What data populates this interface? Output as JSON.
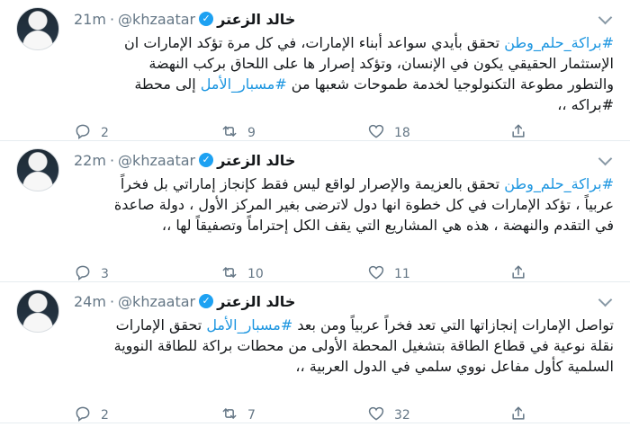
{
  "tweets": [
    {
      "name": "خالد الزعتر",
      "handle": "@khzaatar",
      "separator": "·",
      "time": "21m",
      "lines": [
        [
          {
            "hashtag": "#براكة_حلم_وطن"
          },
          {
            "text": " تحقق بأيدي سواعد أبناء الإمارات، في كل مرة تؤكد الإمارات ان"
          }
        ],
        [
          {
            "text": "الإستثمار الحقيقي يكون في الإنسان، وتؤكد إصرار ها على اللحاق بركب النهضة"
          }
        ],
        [
          {
            "text": "والتطور مطوعة التكنولوجيا لخدمة طموحات شعبها من "
          },
          {
            "hashtag": "#مسبار_الأمل"
          },
          {
            "text": " إلى محطة"
          }
        ],
        [
          {
            "text": "#براكه ،،"
          }
        ]
      ],
      "replies": "2",
      "retweets": "9",
      "likes": "18"
    },
    {
      "name": "خالد الزعتر",
      "handle": "@khzaatar",
      "separator": "·",
      "time": "22m",
      "lines": [
        [
          {
            "hashtag": "#براكة_حلم_وطن"
          },
          {
            "text": " تحقق بالعزيمة والإصرار لواقع ليس فقط كإنجاز إماراتي بل فخراً"
          }
        ],
        [
          {
            "text": "عربياً ، تؤكد الإمارات في كل خطوة انها دول لاترضى بغير المركز الأول ، دولة صاعدة"
          }
        ],
        [
          {
            "text": "في التقدم والنهضة ، هذه هي المشاريع التي يقف الكل إحتراماً وتصفيقاً لها ،،"
          }
        ]
      ],
      "replies": "3",
      "retweets": "10",
      "likes": "11"
    },
    {
      "name": "خالد الزعتر",
      "handle": "@khzaatar",
      "separator": "·",
      "time": "24m",
      "lines": [
        [
          {
            "text": "تواصل الإمارات إنجازاتها التي تعد فخراً عربياً ومن بعد "
          },
          {
            "hashtag": "#مسبار_الأمل"
          },
          {
            "text": " تحقق الإمارات"
          }
        ],
        [
          {
            "text": "نقلة نوعية في قطاع الطاقة بتشغيل المحطة الأولى من محطات براكة للطاقة النووية"
          }
        ],
        [
          {
            "text": "السلمية كأول مفاعل نووي سلمي في الدول العربية ،،"
          }
        ]
      ],
      "replies": "2",
      "retweets": "7",
      "likes": "32"
    }
  ],
  "icons": {
    "verified": "verified-badge-icon",
    "reply": "reply-icon",
    "retweet": "retweet-icon",
    "like": "heart-icon",
    "share": "share-icon",
    "more": "chevron-down-icon"
  },
  "colors": {
    "link": "#1b95e0",
    "verified": "#1da1f2",
    "muted": "#657786"
  }
}
